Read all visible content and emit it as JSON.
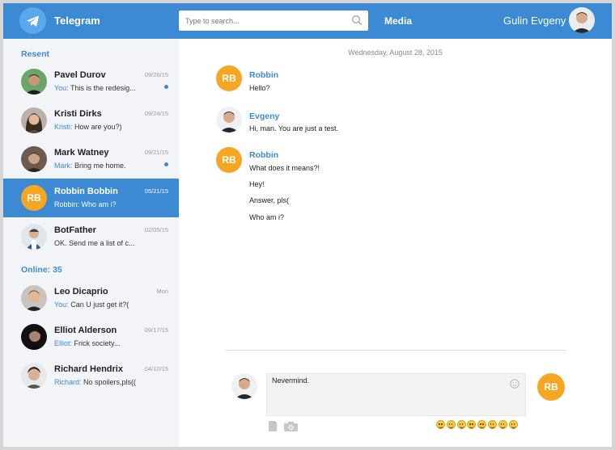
{
  "header": {
    "app_title": "Telegram",
    "search_placeholder": "Type to search...",
    "media_label": "Media",
    "user_name": "Gulin Evgeny",
    "accent_color": "#3c8ad4"
  },
  "sidebar": {
    "recent_title": "Resent",
    "online_title": "Online: 35",
    "recent": [
      {
        "name": "Pavel Durov",
        "date": "09/26/15",
        "sender": "You:",
        "text": " This is the redesig...",
        "unread": true
      },
      {
        "name": "Kristi Dirks",
        "date": "09/24/15",
        "sender": "Kristi:",
        "text": " How are you?)",
        "unread": false
      },
      {
        "name": "Mark Watney",
        "date": "09/21/15",
        "sender": "Mark:",
        "text": " Bring me home.",
        "unread": true
      },
      {
        "name": "Robbin Bobbin",
        "date": "05/21/15",
        "sender": "Robbin:",
        "text": " Who am i?",
        "unread": false,
        "initials": "RB",
        "active": true
      },
      {
        "name": "BotFather",
        "date": "02/05/15",
        "sender": "",
        "text": "OK. Send me a list of c...",
        "unread": false
      }
    ],
    "online": [
      {
        "name": "Leo Dicaprio",
        "date": "Mon",
        "sender": "You:",
        "text": " Can U just get it?("
      },
      {
        "name": "Elliot Alderson",
        "date": "09/17/15",
        "sender": "Elliot:",
        "text": " Frick society..."
      },
      {
        "name": "Richard Hendrix",
        "date": "04/10/15",
        "sender": "Richard:",
        "text": " No spoilers,pls(("
      }
    ]
  },
  "conversation": {
    "date": "Wednesday, August 28, 2015",
    "messages": [
      {
        "sender": "Robbin",
        "initials": "RB",
        "lines": [
          "Hello?"
        ]
      },
      {
        "sender": "Evgeny",
        "lines": [
          "Hi, man. You are just a test."
        ]
      },
      {
        "sender": "Robbin",
        "initials": "RB",
        "lines": [
          "What does it means?!",
          "Hey!",
          "Answer, pls(",
          "Who am i?"
        ]
      }
    ]
  },
  "compose": {
    "value": "Nevermind.",
    "recipient_initials": "RB",
    "emoji_count": 8
  }
}
